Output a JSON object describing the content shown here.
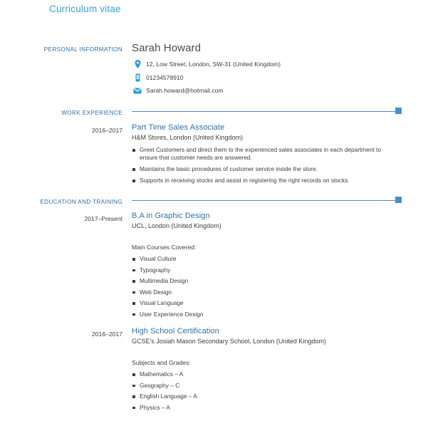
{
  "document": {
    "title": "Curriculum vitae"
  },
  "colors": {
    "title_blue": "#3c9fd9",
    "accent_blue": "#2f6fad",
    "rule_blue": "#4a8fc9",
    "body_text": "#3d3d3d"
  },
  "personal_information": {
    "label": "PERSONAL INFORMATION",
    "name": "Sarah Howard",
    "contacts": [
      {
        "icon": "location-pin-icon",
        "value": "12, Low Street, London, SW-31 (United Kingdom)"
      },
      {
        "icon": "mobile-phone-icon",
        "value": "01234578910"
      },
      {
        "icon": "envelope-icon",
        "value": "Sarah.howard@hotmail.com"
      }
    ]
  },
  "work_experience": {
    "label": "WORK EXPERIENCE",
    "entries": [
      {
        "dates": "2016–2017",
        "title": "Part Time Sales Associate",
        "organisation": "H&M Stores, London (United Kingdom)",
        "bullets": [
          "Greet Customers and direct them to the experienced sales associates in each department to ensure that customer needs are answered.",
          "Maintains the basic procedures of customer service inside the store.",
          "Supports in receiving stocks and assist in registering the right records on stocks."
        ]
      }
    ]
  },
  "education_and_training": {
    "label": "EDUCATION AND TRAINING",
    "entries": [
      {
        "dates": "2017–Present",
        "title": "B.A in Graphic Design",
        "organisation": "UCL, London (United Kingdom)",
        "subheading": "Main Courses Covered:",
        "bullets": [
          "Visual Culture",
          "Typography",
          "Multimedia Design",
          "Web Design",
          "Visual Language",
          "User Experience Design"
        ]
      },
      {
        "dates": "2016–2017",
        "title": "High School Certification",
        "organisation": "GCSE's Josiah Mason Secondary School, London (United Kingdom)",
        "subheading": "Subjects and Grades:",
        "bullets": [
          "Mathematics – A",
          "Geography – C",
          "English Language – A",
          "Physics – A"
        ]
      }
    ]
  }
}
